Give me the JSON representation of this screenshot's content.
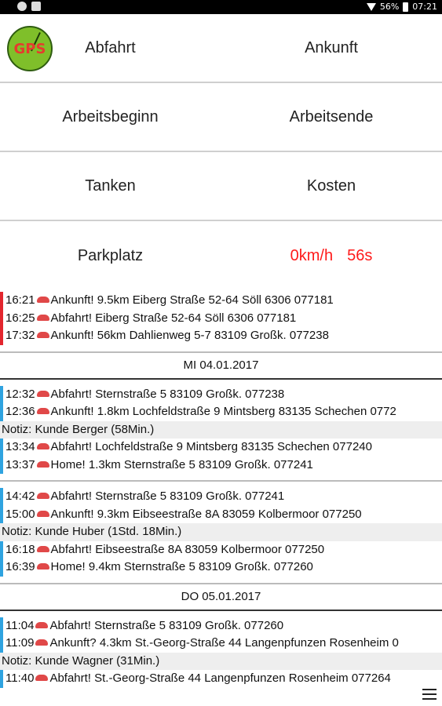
{
  "status_bar": {
    "battery": "56%",
    "time": "07:21"
  },
  "logo": {
    "text": "GPS"
  },
  "buttons": [
    [
      "Abfahrt",
      "Ankunft"
    ],
    [
      "Arbeitsbeginn",
      "Arbeitsende"
    ],
    [
      "Tanken",
      "Kosten"
    ]
  ],
  "parkplatz": "Parkplatz",
  "speed": "0km/h",
  "elapsed": "56s",
  "log": {
    "top_entries": [
      "16:21  Ankunft! 9.5km   Eiberg Straße 52-64 Söll 6306   077181",
      "16:25  Abfahrt!   Eiberg Straße 52-64 Söll 6306   077181",
      "17:32  Ankunft! 56km   Dahlienweg 5-7 83109 Großk.   077238"
    ],
    "day1": "MI 04.01.2017",
    "day1_group1": [
      "12:32  Abfahrt!   Sternstraße 5 83109 Großk.   077238",
      "12:36  Ankunft! 1.8km   Lochfeldstraße 9 Mintsberg 83135 Schechen   0772"
    ],
    "day1_note1": "Notiz: Kunde Berger (58Min.)",
    "day1_group1b": [
      "13:34  Abfahrt!   Lochfeldstraße 9 Mintsberg 83135 Schechen   077240",
      "13:37  Home! 1.3km   Sternstraße 5 83109 Großk.   077241"
    ],
    "day1_group2": [
      "14:42  Abfahrt!   Sternstraße 5 83109 Großk.   077241",
      "15:00  Ankunft! 9.3km   Eibseestraße 8A 83059 Kolbermoor   077250"
    ],
    "day1_note2": "Notiz: Kunde Huber (1Std. 18Min.)",
    "day1_group2b": [
      "16:18  Abfahrt!   Eibseestraße 8A 83059 Kolbermoor   077250",
      "16:39  Home! 9.4km   Sternstraße 5 83109 Großk.   077260"
    ],
    "day2": "DO 05.01.2017",
    "day2_group1": [
      "11:04  Abfahrt!   Sternstraße 5 83109 Großk.   077260",
      "11:09  Ankunft? 4.3km   St.-Georg-Straße 44 Langenpfunzen Rosenheim   0"
    ],
    "day2_note1": "Notiz: Kunde Wagner (31Min.)",
    "day2_group1b": [
      "11:40  Abfahrt!   St.-Georg-Straße 44 Langenpfunzen Rosenheim   077264"
    ]
  },
  "colors": {
    "accent_red": "#ff1a1a",
    "bar_red": "#e3262e",
    "bar_blue": "#2fa3e0"
  },
  "icons": {
    "menu": "menu-icon",
    "car": "car-icon"
  }
}
